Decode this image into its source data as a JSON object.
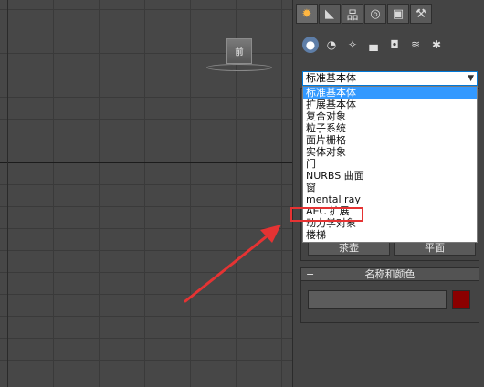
{
  "viewport": {
    "viewcube_label": "前"
  },
  "command_panel": {
    "tabs": [
      {
        "icon": "create-icon",
        "glyph": "✹"
      },
      {
        "icon": "modify-icon",
        "glyph": "◣"
      },
      {
        "icon": "hierarchy-icon",
        "glyph": "品"
      },
      {
        "icon": "motion-icon",
        "glyph": "◎"
      },
      {
        "icon": "display-icon",
        "glyph": "▣"
      },
      {
        "icon": "utilities-icon",
        "glyph": "⚒"
      }
    ],
    "subtabs": [
      {
        "icon": "geometry-icon",
        "glyph": "●"
      },
      {
        "icon": "shapes-icon",
        "glyph": "◔"
      },
      {
        "icon": "lights-icon",
        "glyph": "✧"
      },
      {
        "icon": "cameras-icon",
        "glyph": "▄"
      },
      {
        "icon": "helpers-icon",
        "glyph": "◘"
      },
      {
        "icon": "spacewarps-icon",
        "glyph": "≋"
      },
      {
        "icon": "systems-icon",
        "glyph": "✱"
      }
    ],
    "category_select": {
      "value": "标准基本体"
    },
    "dropdown_options": [
      "标准基本体",
      "扩展基本体",
      "复合对象",
      "粒子系统",
      "面片栅格",
      "实体对象",
      "门",
      "NURBS 曲面",
      "窗",
      "mental ray",
      "AEC 扩展",
      "动力学对象",
      "楼梯"
    ],
    "selected_option": "标准基本体",
    "highlighted_option": "AEC 扩展",
    "under_buttons": [
      "茶壶",
      "平面"
    ],
    "name_and_color": {
      "header": "名称和颜色",
      "collapse": "−",
      "name_value": "",
      "color": "#8b0000"
    }
  },
  "colors": {
    "highlight": "#e53333",
    "selection": "#3399ff"
  }
}
